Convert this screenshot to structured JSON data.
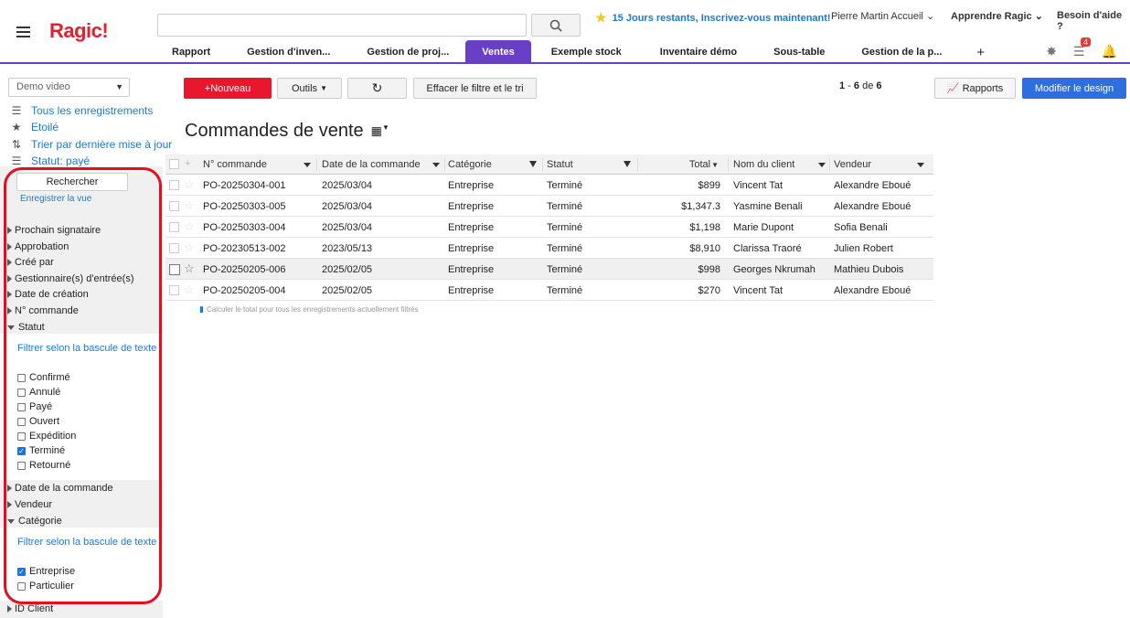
{
  "app": {
    "logo": "Ragic!"
  },
  "header": {
    "trial_text": "15 Jours restants, Inscrivez-vous maintenant!",
    "user_menu": "Pierre Martin Accueil",
    "learn_menu": "Apprendre Ragic",
    "help_menu": "Besoin d'aide ?",
    "notif_count": "4"
  },
  "tabs": [
    {
      "label": "Rapport"
    },
    {
      "label": "Gestion d'inven..."
    },
    {
      "label": "Gestion de proj..."
    },
    {
      "label": "Ventes"
    },
    {
      "label": "Exemple stock"
    },
    {
      "label": "Inventaire démo"
    },
    {
      "label": "Sous-table"
    },
    {
      "label": "Gestion de la p..."
    },
    {
      "label": "+"
    }
  ],
  "sidebar": {
    "view_select": "Demo video",
    "links": [
      {
        "label": "Tous les enregistrements",
        "icon": "list-icon"
      },
      {
        "label": "Etoilé",
        "icon": "star-filter-icon"
      },
      {
        "label": "Trier par dernière mise à jour",
        "icon": "sort-icon"
      },
      {
        "label": "Statut: payé",
        "icon": "list-filter-icon"
      }
    ],
    "search_button": "Rechercher",
    "save_view": "Enregistrer la vue",
    "filters_top": [
      "Prochain signataire",
      "Approbation",
      "Créé par",
      "Gestionnaire(s) d'entrée(s)",
      "Date de création",
      "N° commande"
    ],
    "statut": {
      "label": "Statut",
      "toggle": "Filtrer selon la bascule de texte",
      "options": [
        {
          "label": "Confirmé",
          "checked": false
        },
        {
          "label": "Annulé",
          "checked": false
        },
        {
          "label": "Payé",
          "checked": false
        },
        {
          "label": "Ouvert",
          "checked": false
        },
        {
          "label": "Expédition",
          "checked": false
        },
        {
          "label": "Terminé",
          "checked": true
        },
        {
          "label": "Retourné",
          "checked": false
        }
      ]
    },
    "filters_mid": [
      "Date de la commande",
      "Vendeur"
    ],
    "categorie": {
      "label": "Catégorie",
      "toggle": "Filtrer selon la bascule de texte",
      "options": [
        {
          "label": "Entreprise",
          "checked": true
        },
        {
          "label": "Particulier",
          "checked": false
        }
      ]
    },
    "filters_bottom": [
      "ID Client"
    ]
  },
  "toolbar": {
    "new": "+Nouveau",
    "tools": "Outils",
    "clear": "Effacer le filtre et le tri",
    "pager_from": "1",
    "pager_to": "6",
    "pager_of": "de",
    "pager_total": "6",
    "reports": "Rapports",
    "design": "Modifier le design"
  },
  "page_title": "Commandes de vente",
  "table": {
    "columns": [
      "N° commande",
      "Date de la commande",
      "Catégorie",
      "Statut",
      "Total",
      "Nom du client",
      "Vendeur"
    ],
    "rows": [
      [
        "PO-20250304-001",
        "2025/03/04",
        "Entreprise",
        "Terminé",
        "$899",
        "Vincent Tat",
        "Alexandre Eboué"
      ],
      [
        "PO-20250303-005",
        "2025/03/04",
        "Entreprise",
        "Terminé",
        "$1,347.3",
        "Yasmine Benali",
        "Alexandre Eboué"
      ],
      [
        "PO-20250303-004",
        "2025/03/04",
        "Entreprise",
        "Terminé",
        "$1,198",
        "Marie Dupont",
        "Sofia Benali"
      ],
      [
        "PO-20230513-002",
        "2023/05/13",
        "Entreprise",
        "Terminé",
        "$8,910",
        "Clarissa Traoré",
        "Julien Robert"
      ],
      [
        "PO-20250205-006",
        "2025/02/05",
        "Entreprise",
        "Terminé",
        "$998",
        "Georges Nkrumah",
        "Mathieu Dubois"
      ],
      [
        "PO-20250205-004",
        "2025/02/05",
        "Entreprise",
        "Terminé",
        "$270",
        "Vincent Tat",
        "Alexandre Eboué"
      ]
    ],
    "calc_note": "Calculer le total pour tous les enregistrements actuellement filtrés"
  }
}
